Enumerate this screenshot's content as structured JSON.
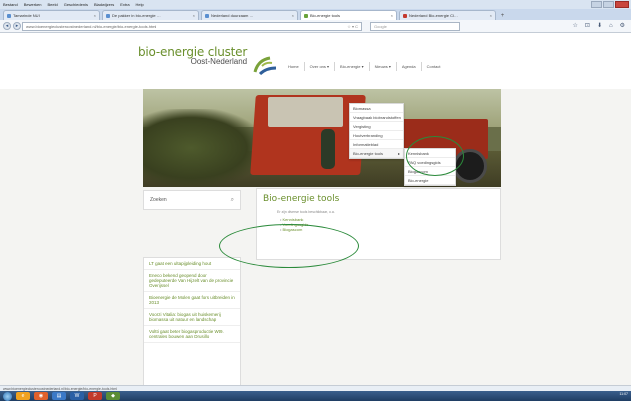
{
  "browser": {
    "menu": [
      "Bestand",
      "Bewerken",
      "Beeld",
      "Geschiedenis",
      "Bladwijzers",
      "Extra",
      "Help"
    ],
    "tabs": [
      {
        "title": "Tamarinde NUI",
        "fav": "blue"
      },
      {
        "title": "De pakker in bio-energie …",
        "fav": "blue"
      },
      {
        "title": "Nederland duurzaam …",
        "fav": "blue"
      },
      {
        "title": "Bio-energie tools",
        "fav": "green",
        "active": true
      },
      {
        "title": "Nederland Bio-energie Cl…",
        "fav": "red"
      }
    ],
    "newtab": "+",
    "url": "www.bioenergieclusteroostnederland.nl/bio-energie/bio-energie-tools.html",
    "url_right": "☆ ▾ C",
    "search_placeholder": "Google",
    "toolbar_icons": [
      "☆",
      "⊡",
      "⬇",
      "⌂",
      "⚙"
    ]
  },
  "site": {
    "logo_line1": "bio-energie cluster",
    "logo_line2": "Oost-Nederland",
    "nav": [
      "Home",
      "Over ons ▾",
      "Bio-energie ▾",
      "Nieuws ▾",
      "Agenda",
      "Contact"
    ],
    "dropdown": [
      "Biomassa",
      "Vraagbaak biobrandstoffen",
      "Vergisting",
      "Houtverbranding",
      "Informatieblad",
      "Bio-energie tools"
    ],
    "submenu": [
      "Kennisbank",
      "PAQ voedingsgids",
      "Biogascom",
      "Bio-energie"
    ],
    "search_label": "Zoeken",
    "search_icon": "⌕",
    "news": [
      "LT gaat een ultapijpleiding hout",
      "Eneco bekend geopend door gedeputeerde Van Hijzelt van de provincie Overijssel",
      "Bioenergie de Molen gaat fors uitbreiden in 2013",
      "Voorzi Vitalia: biogas uit huiskemerij biomassa uit natuur en landschap",
      "Voltti gaat beter biogasproductie Wt9. centrales bouwen aan Drusillo"
    ],
    "pager": [
      "‹",
      "1",
      "2",
      "3",
      "4",
      "5",
      "6",
      "7",
      "8",
      "9",
      "10",
      "›"
    ],
    "content_title": "Bio-energie tools",
    "content_intro": "Er zijn diverse tools beschikbaar, o.a.",
    "content_items": [
      "Kennisbank",
      "Voedingssgids",
      "Biogascom"
    ]
  },
  "status_text": "www.bioenergieclusteroostnederland.nl/bio-energie/bio-energie-tools.html",
  "tray_time": "11:07"
}
